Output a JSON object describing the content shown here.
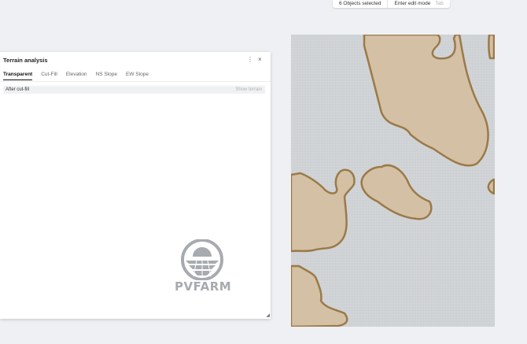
{
  "toolbar": {
    "selection_status": "6 Objects selected",
    "edit_mode_label": "Enter edit mode",
    "edit_mode_hint": "Tab"
  },
  "panel": {
    "title": "Terrain analysis",
    "more_icon": "vertical-dots-icon",
    "close_icon": "close-icon",
    "tabs": [
      {
        "label": "Transparent",
        "active": true
      },
      {
        "label": "Cut-Fill",
        "active": false
      },
      {
        "label": "Elevation",
        "active": false
      },
      {
        "label": "NS Slope",
        "active": false
      },
      {
        "label": "EW Slope",
        "active": false
      }
    ],
    "row": {
      "label": "After cut-fill",
      "action": "Show terrain"
    },
    "logo_text": "PVFARM"
  },
  "colors": {
    "terrain_fill": "#d4c0a5",
    "terrain_stroke": "#9a7a48",
    "grid_background": "#d7d9dc",
    "panel_background": "#ffffff",
    "logo_gray": "#a7abaf"
  }
}
